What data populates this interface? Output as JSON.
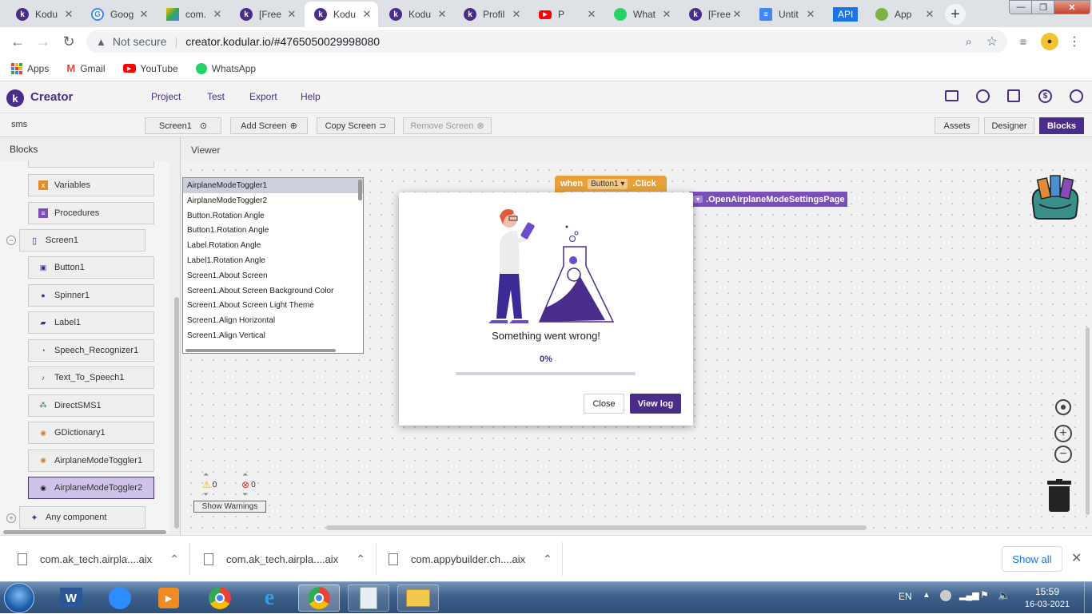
{
  "browser": {
    "tabs": [
      {
        "title": "Kodu",
        "fav": "kodular-icon",
        "color": "#4a2c8a"
      },
      {
        "title": "Goog",
        "fav": "google-icon",
        "color": "#ffffff"
      },
      {
        "title": "com.",
        "fav": "google-drive-icon",
        "color": "#ffffff"
      },
      {
        "title": "[Free",
        "fav": "kodular-icon",
        "color": "#4a2c8a"
      },
      {
        "title": "Kodu",
        "fav": "kodular-icon",
        "color": "#4a2c8a",
        "active": true
      },
      {
        "title": "Kodu",
        "fav": "kodular-icon",
        "color": "#4a2c8a"
      },
      {
        "title": "Profil",
        "fav": "kodular-icon",
        "color": "#4a2c8a"
      },
      {
        "title": "P",
        "fav": "youtube-icon",
        "color": "#ff0000"
      },
      {
        "title": "What",
        "fav": "whatsapp-icon",
        "color": "#25d366"
      },
      {
        "title": "[Free",
        "fav": "kodular-icon",
        "color": "#4a2c8a"
      },
      {
        "title": "Untit",
        "fav": "docs-icon",
        "color": "#4285f4"
      },
      {
        "title": "API",
        "fav": "api-icon",
        "color": "#1a73e8"
      },
      {
        "title": "App",
        "fav": "appybuilder-icon",
        "color": "#ffffff"
      }
    ],
    "not_secure": "Not secure",
    "url": "creator.kodular.io/#4765050029998080",
    "bookmarks": [
      {
        "label": "Apps",
        "icon": "apps-grid-icon"
      },
      {
        "label": "Gmail",
        "icon": "gmail-icon"
      },
      {
        "label": "YouTube",
        "icon": "youtube-icon"
      },
      {
        "label": "WhatsApp",
        "icon": "whatsapp-icon"
      }
    ]
  },
  "app": {
    "brand": "Creator",
    "menu": [
      "Project",
      "Test",
      "Export",
      "Help"
    ],
    "project_name": "sms",
    "screen_select": "Screen1",
    "add_screen": "Add Screen",
    "copy_screen": "Copy Screen",
    "remove_screen": "Remove Screen",
    "view_tabs": [
      "Assets",
      "Designer",
      "Blocks"
    ],
    "blocks_title": "Blocks",
    "viewer_title": "Viewer",
    "tree": {
      "builtins": [
        "Variables",
        "Procedures"
      ],
      "screen": "Screen1",
      "components": [
        "Button1",
        "Spinner1",
        "Label1",
        "Speech_Recognizer1",
        "Text_To_Speech1",
        "DirectSMS1",
        "GDictionary1",
        "AirplaneModeToggler1",
        "AirplaneModeToggler2"
      ],
      "any": "Any component"
    },
    "dropdown_items": [
      "AirplaneModeToggler1",
      "AirplaneModeToggler2",
      "Button.Rotation Angle",
      "Button1.Rotation Angle",
      "Label.Rotation Angle",
      "Label1.Rotation Angle",
      "Screen1.About Screen",
      "Screen1.About Screen Background Color",
      "Screen1.About Screen Light Theme",
      "Screen1.Align Horizontal",
      "Screen1.Align Vertical"
    ],
    "block": {
      "when": "when",
      "component": "Button1",
      "event": ".Click",
      "method": ".OpenAirplaneModeSettingsPage"
    },
    "warnings": {
      "warn_count": "0",
      "error_count": "0",
      "button": "Show Warnings"
    }
  },
  "modal": {
    "message": "Something went wrong!",
    "progress_text": "0%",
    "progress": 0,
    "close": "Close",
    "view_log": "View log"
  },
  "downloads": {
    "items": [
      "com.ak_tech.airpla....aix",
      "com.ak_tech.airpla....aix",
      "com.appybuilder.ch....aix"
    ],
    "show_all": "Show all"
  },
  "taskbar": {
    "lang": "EN",
    "time": "15:59",
    "date": "16-03-2021"
  },
  "colors": {
    "kodular_purple": "#4a2c8a",
    "block_orange": "#e8a13a",
    "block_purple": "#7a4fb8"
  }
}
